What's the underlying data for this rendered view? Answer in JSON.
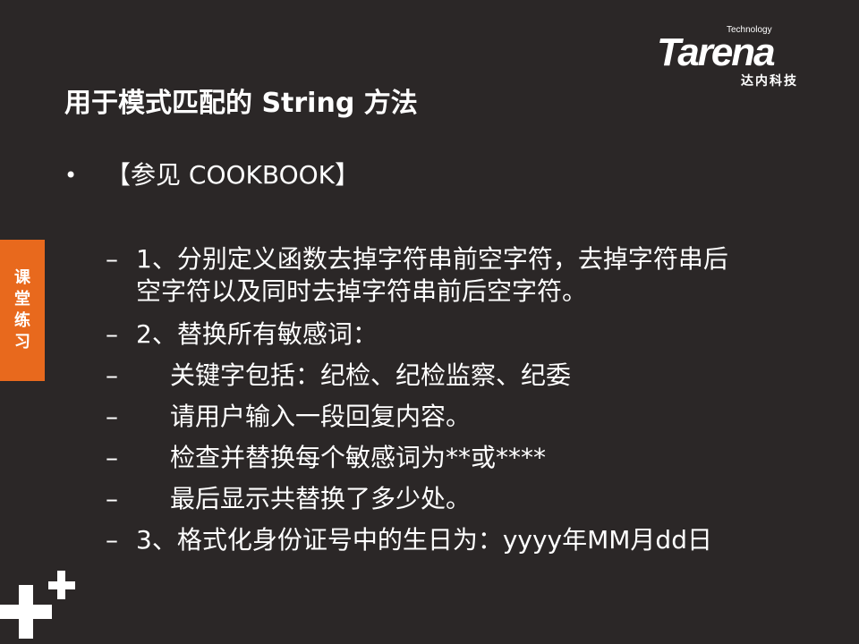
{
  "logo": {
    "technology": "Technology",
    "brand": "Tarena",
    "subtitle": "达内科技"
  },
  "title": "用于模式匹配的 String 方法",
  "bullet": {
    "symbol": "•",
    "text": "【参见 COOKBOOK】"
  },
  "items": [
    {
      "dash": "–",
      "text": "1、分别定义函数去掉字符串前空字符，去掉字符串后"
    },
    {
      "dash": "",
      "text": "空字符以及同时去掉字符串前后空字符。"
    },
    {
      "dash": "–",
      "text": "2、替换所有敏感词："
    },
    {
      "dash": "–",
      "text": "关键字包括：纪检、纪检监察、纪委"
    },
    {
      "dash": "–",
      "text": "请用户输入一段回复内容。"
    },
    {
      "dash": "–",
      "text": "检查并替换每个敏感词为**或****"
    },
    {
      "dash": "–",
      "text": "最后显示共替换了多少处。"
    },
    {
      "dash": "–",
      "text": "3、格式化身份证号中的生日为：yyyy年MM月dd日"
    }
  ],
  "side_tab": {
    "chars": [
      "课",
      "堂",
      "练",
      "习"
    ],
    "color": "#e8691d"
  },
  "colors": {
    "background": "#2b2727",
    "text": "#ffffff",
    "accent": "#e8691d"
  }
}
